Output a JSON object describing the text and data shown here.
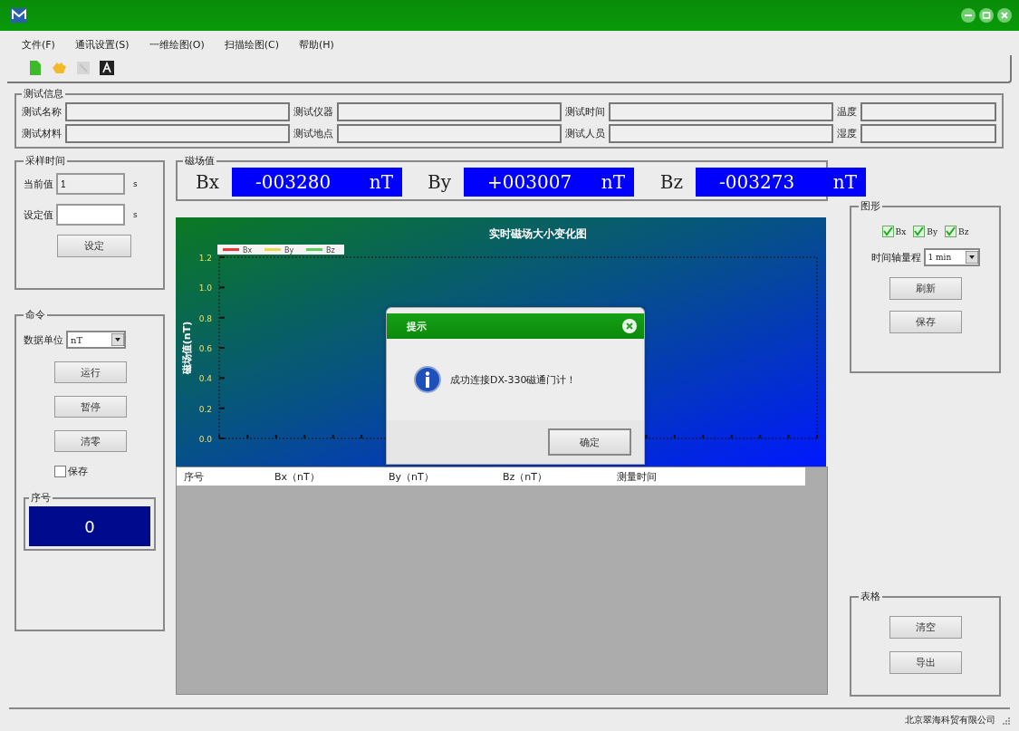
{
  "menu": [
    "文件(F)",
    "通讯设置(S)",
    "一维绘图(O)",
    "扫描绘图(C)",
    "帮助(H)"
  ],
  "test_info": {
    "title": "测试信息",
    "fields": [
      {
        "label": "测试名称"
      },
      {
        "label": "测试仪器"
      },
      {
        "label": "测试时间"
      },
      {
        "label": "温度"
      },
      {
        "label": "测试材料"
      },
      {
        "label": "测试地点"
      },
      {
        "label": "测试人员"
      },
      {
        "label": "湿度"
      }
    ]
  },
  "sampling": {
    "title": "采样时间",
    "current_label": "当前值",
    "current_value": "1",
    "current_unit": "s",
    "set_label": "设定值",
    "set_unit": "s",
    "set_button": "设定"
  },
  "command": {
    "title": "命令",
    "unit_label": "数据单位",
    "unit_value": "nT",
    "buttons": [
      "运行",
      "暂停",
      "清零"
    ],
    "save_label": "保存",
    "save_checked": false,
    "serial_title": "序号",
    "serial_value": "0"
  },
  "field_values": {
    "title": "磁场值",
    "readings": [
      {
        "axis": "Bx",
        "value": "-003280",
        "unit": "nT"
      },
      {
        "axis": "By",
        "value": "+003007",
        "unit": "nT"
      },
      {
        "axis": "Bz",
        "value": "-003273",
        "unit": "nT"
      }
    ]
  },
  "chart": {
    "title": "实时磁场大小变化图",
    "ylabel": "磁场值(nT)",
    "y_tick_labels": [
      "1.2",
      "1.0",
      "0.8",
      "0.6",
      "0.4",
      "0.2",
      "0.0"
    ],
    "legend": [
      {
        "name": "Bx",
        "color": "#e83a3a"
      },
      {
        "name": "By",
        "color": "#e8d84a"
      },
      {
        "name": "Bz",
        "color": "#5ad05a"
      }
    ]
  },
  "table": {
    "columns": [
      "序号",
      "Bx（nT）",
      "By（nT）",
      "Bz（nT）",
      "测量时间"
    ]
  },
  "graph": {
    "title": "图形",
    "checks": [
      {
        "label": "Bx",
        "checked": true
      },
      {
        "label": "By",
        "checked": true
      },
      {
        "label": "Bz",
        "checked": true
      }
    ],
    "range_label": "时间轴量程",
    "range_value": "1 min",
    "buttons": [
      "刷新",
      "保存"
    ]
  },
  "table_panel": {
    "title": "表格",
    "buttons": [
      "清空",
      "导出"
    ]
  },
  "dialog": {
    "title": "提示",
    "message": "成功连接DX-330磁通门计！",
    "ok": "确定"
  },
  "status_bar": "北京翠海科贸有限公司"
}
